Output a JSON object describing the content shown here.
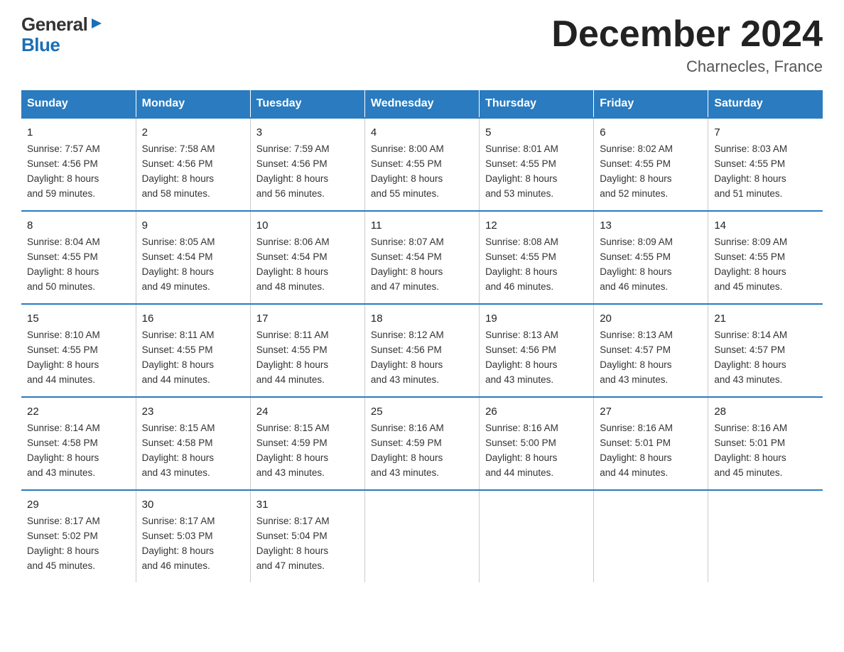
{
  "header": {
    "logo": {
      "general": "General",
      "triangle": "▶",
      "blue": "Blue"
    },
    "title": "December 2024",
    "location": "Charnecles, France"
  },
  "days_of_week": [
    "Sunday",
    "Monday",
    "Tuesday",
    "Wednesday",
    "Thursday",
    "Friday",
    "Saturday"
  ],
  "weeks": [
    [
      {
        "day": "1",
        "sunrise": "7:57 AM",
        "sunset": "4:56 PM",
        "daylight": "8 hours and 59 minutes."
      },
      {
        "day": "2",
        "sunrise": "7:58 AM",
        "sunset": "4:56 PM",
        "daylight": "8 hours and 58 minutes."
      },
      {
        "day": "3",
        "sunrise": "7:59 AM",
        "sunset": "4:56 PM",
        "daylight": "8 hours and 56 minutes."
      },
      {
        "day": "4",
        "sunrise": "8:00 AM",
        "sunset": "4:55 PM",
        "daylight": "8 hours and 55 minutes."
      },
      {
        "day": "5",
        "sunrise": "8:01 AM",
        "sunset": "4:55 PM",
        "daylight": "8 hours and 53 minutes."
      },
      {
        "day": "6",
        "sunrise": "8:02 AM",
        "sunset": "4:55 PM",
        "daylight": "8 hours and 52 minutes."
      },
      {
        "day": "7",
        "sunrise": "8:03 AM",
        "sunset": "4:55 PM",
        "daylight": "8 hours and 51 minutes."
      }
    ],
    [
      {
        "day": "8",
        "sunrise": "8:04 AM",
        "sunset": "4:55 PM",
        "daylight": "8 hours and 50 minutes."
      },
      {
        "day": "9",
        "sunrise": "8:05 AM",
        "sunset": "4:54 PM",
        "daylight": "8 hours and 49 minutes."
      },
      {
        "day": "10",
        "sunrise": "8:06 AM",
        "sunset": "4:54 PM",
        "daylight": "8 hours and 48 minutes."
      },
      {
        "day": "11",
        "sunrise": "8:07 AM",
        "sunset": "4:54 PM",
        "daylight": "8 hours and 47 minutes."
      },
      {
        "day": "12",
        "sunrise": "8:08 AM",
        "sunset": "4:55 PM",
        "daylight": "8 hours and 46 minutes."
      },
      {
        "day": "13",
        "sunrise": "8:09 AM",
        "sunset": "4:55 PM",
        "daylight": "8 hours and 46 minutes."
      },
      {
        "day": "14",
        "sunrise": "8:09 AM",
        "sunset": "4:55 PM",
        "daylight": "8 hours and 45 minutes."
      }
    ],
    [
      {
        "day": "15",
        "sunrise": "8:10 AM",
        "sunset": "4:55 PM",
        "daylight": "8 hours and 44 minutes."
      },
      {
        "day": "16",
        "sunrise": "8:11 AM",
        "sunset": "4:55 PM",
        "daylight": "8 hours and 44 minutes."
      },
      {
        "day": "17",
        "sunrise": "8:11 AM",
        "sunset": "4:55 PM",
        "daylight": "8 hours and 44 minutes."
      },
      {
        "day": "18",
        "sunrise": "8:12 AM",
        "sunset": "4:56 PM",
        "daylight": "8 hours and 43 minutes."
      },
      {
        "day": "19",
        "sunrise": "8:13 AM",
        "sunset": "4:56 PM",
        "daylight": "8 hours and 43 minutes."
      },
      {
        "day": "20",
        "sunrise": "8:13 AM",
        "sunset": "4:57 PM",
        "daylight": "8 hours and 43 minutes."
      },
      {
        "day": "21",
        "sunrise": "8:14 AM",
        "sunset": "4:57 PM",
        "daylight": "8 hours and 43 minutes."
      }
    ],
    [
      {
        "day": "22",
        "sunrise": "8:14 AM",
        "sunset": "4:58 PM",
        "daylight": "8 hours and 43 minutes."
      },
      {
        "day": "23",
        "sunrise": "8:15 AM",
        "sunset": "4:58 PM",
        "daylight": "8 hours and 43 minutes."
      },
      {
        "day": "24",
        "sunrise": "8:15 AM",
        "sunset": "4:59 PM",
        "daylight": "8 hours and 43 minutes."
      },
      {
        "day": "25",
        "sunrise": "8:16 AM",
        "sunset": "4:59 PM",
        "daylight": "8 hours and 43 minutes."
      },
      {
        "day": "26",
        "sunrise": "8:16 AM",
        "sunset": "5:00 PM",
        "daylight": "8 hours and 44 minutes."
      },
      {
        "day": "27",
        "sunrise": "8:16 AM",
        "sunset": "5:01 PM",
        "daylight": "8 hours and 44 minutes."
      },
      {
        "day": "28",
        "sunrise": "8:16 AM",
        "sunset": "5:01 PM",
        "daylight": "8 hours and 45 minutes."
      }
    ],
    [
      {
        "day": "29",
        "sunrise": "8:17 AM",
        "sunset": "5:02 PM",
        "daylight": "8 hours and 45 minutes."
      },
      {
        "day": "30",
        "sunrise": "8:17 AM",
        "sunset": "5:03 PM",
        "daylight": "8 hours and 46 minutes."
      },
      {
        "day": "31",
        "sunrise": "8:17 AM",
        "sunset": "5:04 PM",
        "daylight": "8 hours and 47 minutes."
      },
      null,
      null,
      null,
      null
    ]
  ],
  "labels": {
    "sunrise": "Sunrise:",
    "sunset": "Sunset:",
    "daylight": "Daylight:"
  }
}
